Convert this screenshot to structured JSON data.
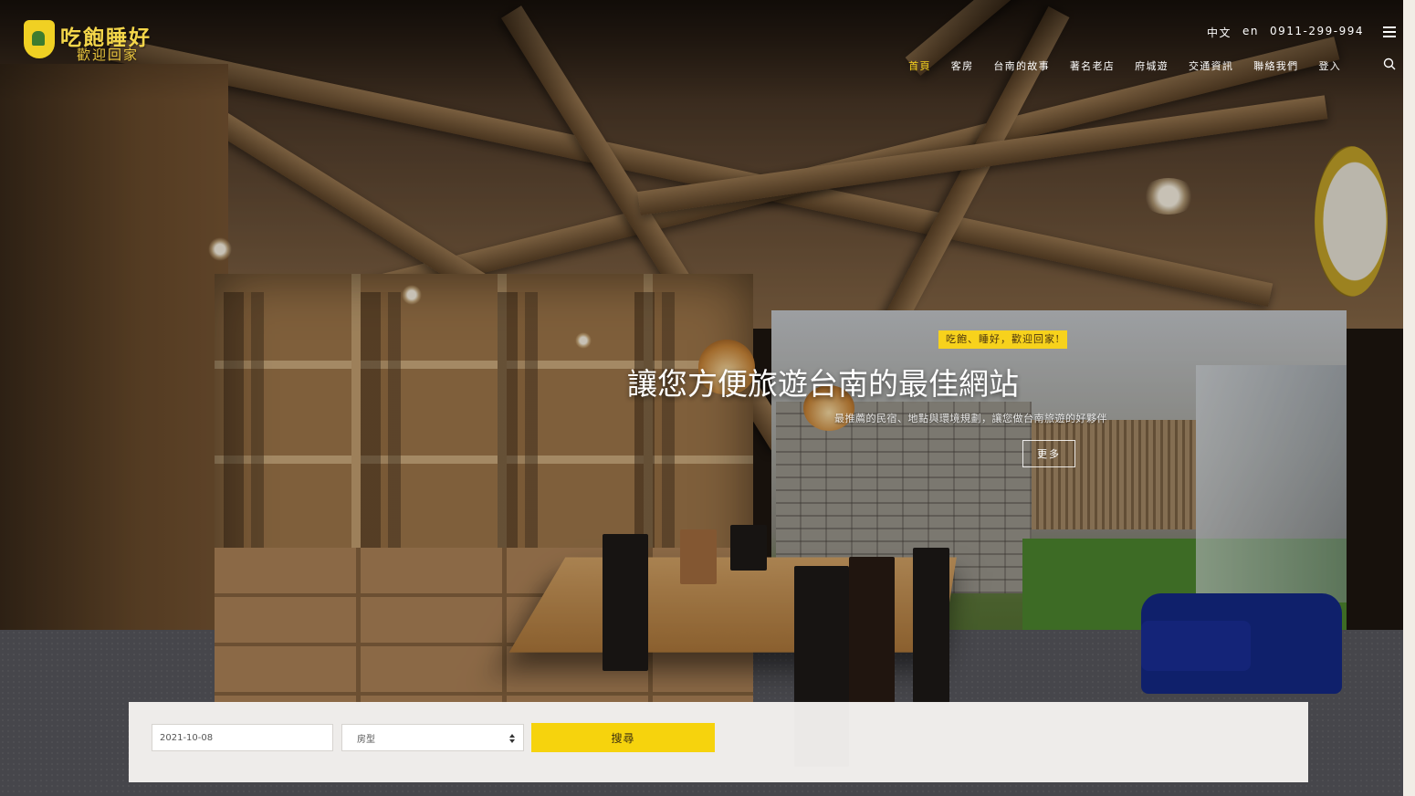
{
  "header": {
    "logo": {
      "title": "吃飽睡好",
      "subtitle": "歡迎回家"
    },
    "lang_zh": "中文",
    "lang_en": "en",
    "phone": "0911-299-994"
  },
  "nav": {
    "items": [
      {
        "label": "首頁",
        "active": true
      },
      {
        "label": "客房",
        "active": false
      },
      {
        "label": "台南的故事",
        "active": false
      },
      {
        "label": "著名老店",
        "active": false
      },
      {
        "label": "府城遊",
        "active": false
      },
      {
        "label": "交通資訊",
        "active": false
      },
      {
        "label": "聯絡我們",
        "active": false
      },
      {
        "label": "登入",
        "active": false
      }
    ]
  },
  "hero": {
    "badge": "吃飽、睡好，歡迎回家!",
    "title": "讓您方便旅遊台南的最佳網站",
    "subtitle": "最推薦的民宿、地點與環境規劃，讓您做台南旅遊的好夥伴",
    "more_label": "更多"
  },
  "booking": {
    "date_value": "2021-10-08",
    "room_type_selected": "房型",
    "search_label": "搜尋"
  },
  "colors": {
    "accent": "#f7d21c",
    "nav_active": "#f7d21c",
    "text_light": "#ffffff",
    "booking_bg": "#f5f3f0"
  },
  "icons": [
    "hamburger-menu-icon",
    "search-icon",
    "logo-house-icon",
    "select-arrows-icon"
  ]
}
